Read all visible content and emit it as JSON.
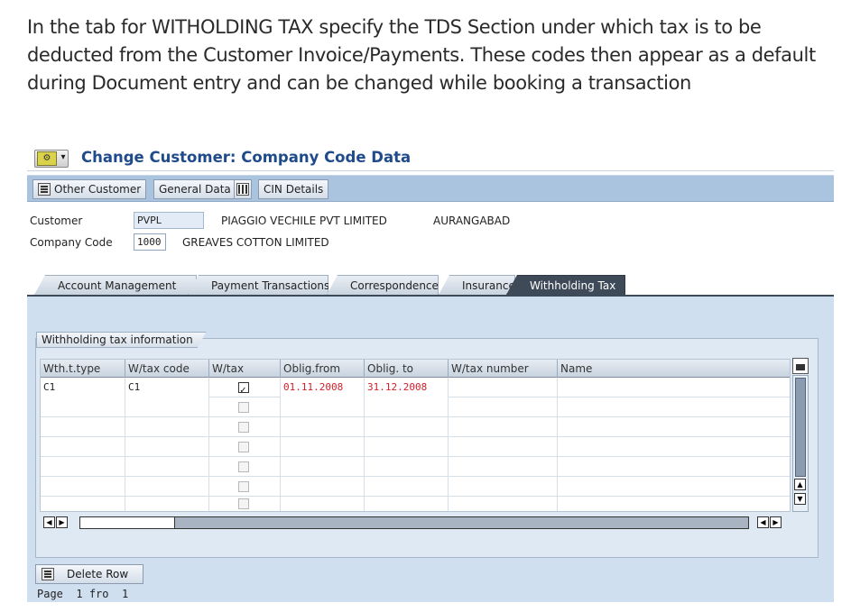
{
  "intro_text": "In the tab for WITHOLDING TAX specify the TDS Section under which tax is to be deducted from the Customer Invoice/Payments. These codes then appear as a default during Document entry and can be changed while booking a transaction",
  "window": {
    "title": "Change Customer: Company Code Data"
  },
  "toolbar": {
    "other_customer": "Other Customer",
    "general_data": "General Data",
    "cin_details": "CIN Details"
  },
  "header": {
    "customer_label": "Customer",
    "customer_value": "PVPL",
    "customer_name": "PIAGGIO VECHILE PVT LIMITED",
    "customer_city": "AURANGABAD",
    "company_code_label": "Company Code",
    "company_code_value": "1000",
    "company_name": "GREAVES COTTON LIMITED"
  },
  "tabs": [
    {
      "label": "Account Management",
      "active": false
    },
    {
      "label": "Payment Transactions",
      "active": false
    },
    {
      "label": "Correspondence",
      "active": false
    },
    {
      "label": "Insurance",
      "active": false
    },
    {
      "label": "Withholding Tax",
      "active": true
    }
  ],
  "withholding": {
    "group_title": "Withholding tax information",
    "columns": [
      "Wth.t.type",
      "W/tax code",
      "W/tax",
      "Oblig.from",
      "Oblig. to",
      "W/tax number",
      "Name"
    ],
    "rows": [
      {
        "type": "C1",
        "code": "C1",
        "wtax": true,
        "from": "01.11.2008",
        "to": "31.12.2008",
        "number": "",
        "name": ""
      },
      {
        "type": "",
        "code": "",
        "wtax": false,
        "from": "",
        "to": "",
        "number": "",
        "name": ""
      },
      {
        "type": "",
        "code": "",
        "wtax": false,
        "from": "",
        "to": "",
        "number": "",
        "name": ""
      },
      {
        "type": "",
        "code": "",
        "wtax": false,
        "from": "",
        "to": "",
        "number": "",
        "name": ""
      },
      {
        "type": "",
        "code": "",
        "wtax": false,
        "from": "",
        "to": "",
        "number": "",
        "name": ""
      },
      {
        "type": "",
        "code": "",
        "wtax": false,
        "from": "",
        "to": "",
        "number": "",
        "name": ""
      },
      {
        "type": "",
        "code": "",
        "wtax": false,
        "from": "",
        "to": "",
        "number": "",
        "name": ""
      }
    ]
  },
  "footer": {
    "delete_row": "Delete Row",
    "page_label": "Page",
    "page_current": "1",
    "page_of": "fro",
    "page_total": "1"
  },
  "colors": {
    "title": "#1f4b8a",
    "toolbar": "#aac4e0",
    "active_tab": "#3f4a59",
    "date_text": "#d2202a"
  }
}
